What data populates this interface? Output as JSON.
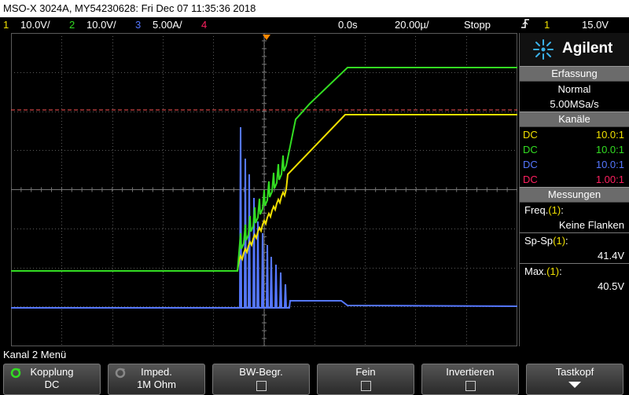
{
  "titlebar": "MSO-X 3024A, MY54230628: Fri Dec 07 11:35:36 2018",
  "status": {
    "ch1_num": "1",
    "ch1_scale": "10.0V/",
    "ch2_num": "2",
    "ch2_scale": "10.0V/",
    "ch3_num": "3",
    "ch3_scale": "5.00A/",
    "ch4_num": "4",
    "time_offset": "0.0s",
    "time_scale": "20.00µ/",
    "run_state": "Stopp",
    "trig_icon": "trigger-edge-icon",
    "trig_ch": "1",
    "trig_level": "15.0V"
  },
  "panel": {
    "brand": "Agilent",
    "acq_header": "Erfassung",
    "acq_mode": "Normal",
    "acq_rate": "5.00MSa/s",
    "channels_header": "Kanäle",
    "channels": [
      {
        "coupling": "DC",
        "ratio": "10.0:1",
        "color": "#f0e000"
      },
      {
        "coupling": "DC",
        "ratio": "10.0:1",
        "color": "#33dd22"
      },
      {
        "coupling": "DC",
        "ratio": "10.0:1",
        "color": "#5577ff"
      },
      {
        "coupling": "DC",
        "ratio": "1.00:1",
        "color": "#ff2060"
      }
    ],
    "meas_header": "Messungen",
    "meas": [
      {
        "name": "Freq.",
        "ch": "(1)",
        "colon": ":",
        "value": "Keine Flanken"
      },
      {
        "name": "Sp-Sp",
        "ch": "(1)",
        "colon": ":",
        "value": "41.4V"
      },
      {
        "name": "Max.",
        "ch": "(1)",
        "colon": ":",
        "value": "40.5V"
      }
    ]
  },
  "menu_title": "Kanal 2 Menü",
  "softkeys": [
    {
      "label": "Kopplung",
      "value": "DC"
    },
    {
      "label": "Imped.",
      "value": "1M Ohm"
    },
    {
      "label": "BW-Begr.",
      "value": ""
    },
    {
      "label": "Fein",
      "value": ""
    },
    {
      "label": "Invertieren",
      "value": ""
    },
    {
      "label": "Tastkopf",
      "value": ""
    }
  ],
  "markers": {
    "trigger_level_label": "T",
    "ch1_ground": "1",
    "ch2_ground": "2",
    "ch3_ground": "3"
  },
  "colors": {
    "ch1": "#f0e000",
    "ch2": "#33dd22",
    "ch3": "#5577ff",
    "ch4": "#ff2060",
    "trigger_line": "#ff5555",
    "grid": "#5a5a5a",
    "panel_header": "#6b6b6b"
  }
}
